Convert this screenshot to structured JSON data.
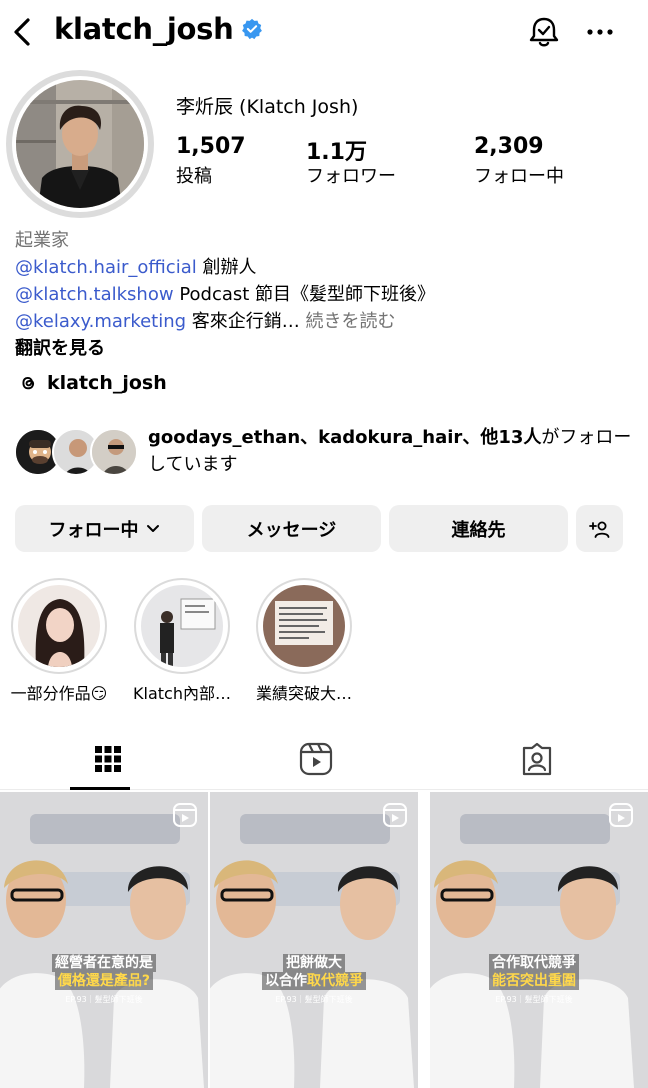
{
  "header": {
    "username": "klatch_josh",
    "icons": [
      "back-icon",
      "verified-badge-icon",
      "notification-bell-icon",
      "more-icon"
    ]
  },
  "profile": {
    "display_name": "李炘辰 (Klatch Josh)",
    "stats": [
      {
        "value": "1,507",
        "label": "投稿"
      },
      {
        "value": "1.1万",
        "label": "フォロワー"
      },
      {
        "value": "2,309",
        "label": "フォロー中"
      }
    ]
  },
  "bio": {
    "category": "起業家",
    "lines": [
      {
        "mention": "@klatch.hair_official",
        "text": "創辦人"
      },
      {
        "mention": "@klatch.talkshow",
        "text": "Podcast 節目《髮型師下班後》"
      },
      {
        "mention": "@kelaxy.marketing",
        "text": "客來企行銷…",
        "more": "続きを読む"
      }
    ],
    "translate": "翻訳を見る"
  },
  "threads": {
    "handle": "klatch_josh",
    "icon": "threads-icon"
  },
  "mutual": {
    "names": "goodays_ethan、kadokura_hair、他13人",
    "suffix": "がフォローしています"
  },
  "actions": {
    "follow": "フォロー中",
    "message": "メッセージ",
    "contact": "連絡先",
    "add_icon": "add-person-icon"
  },
  "highlights": [
    {
      "label": "一部分作品😏"
    },
    {
      "label": "Klatch內部…"
    },
    {
      "label": "業績突破大…"
    }
  ],
  "tabs": [
    "grid-icon",
    "reels-icon",
    "tagged-icon"
  ],
  "posts": [
    {
      "line1": "經營者在意的是",
      "line2": "價格還是產品?",
      "episode": "EP.93｜髮型師下班後"
    },
    {
      "line1": "把餅做大",
      "line2a": "以合作",
      "line2b": "取代競爭",
      "episode": "EP.93｜髮型師下班後"
    },
    {
      "line1": "合作取代競爭",
      "line2": "能否突出重圍",
      "episode": "EP.93｜髮型師下班後"
    }
  ],
  "colors": {
    "link": "#3b5bcc",
    "button_bg": "#efefef",
    "verified": "#3897f0",
    "muted": "#737373"
  }
}
